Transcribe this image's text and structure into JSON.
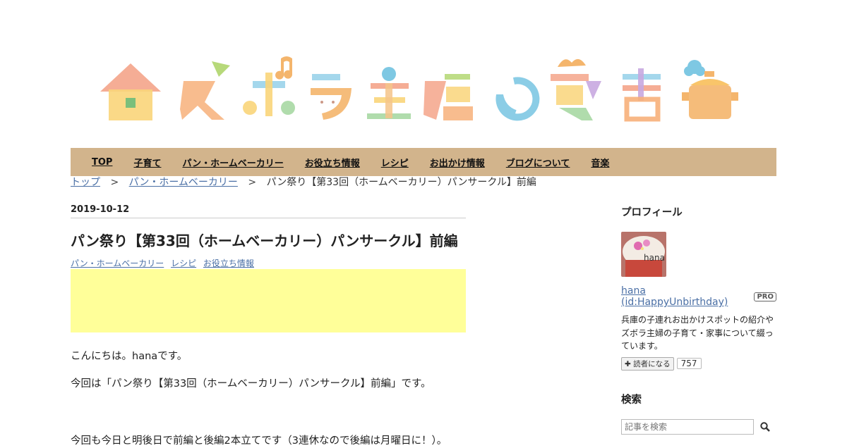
{
  "logo": {
    "alt_text": "ズボラ主婦の覚書"
  },
  "nav": {
    "items": [
      "TOP",
      "子育て",
      "パン・ホームベーカリー",
      "お役立ち情報",
      "レシピ",
      "お出かけ情報",
      "ブログについて",
      "音楽"
    ]
  },
  "breadcrumb": {
    "items": [
      "トップ",
      "パン・ホームベーカリー"
    ],
    "separator": ">",
    "current": "パン祭り【第33回（ホームベーカリー）パンサークル】前編"
  },
  "entry": {
    "date": "2019-10-12",
    "title": "パン祭り【第33回（ホームベーカリー）パンサークル】前編",
    "categories": [
      "パン・ホームベーカリー",
      "レシピ",
      "お役立ち情報"
    ],
    "paragraphs": [
      "こんにちは。hanaです。",
      "今回は「パン祭り【第33回（ホームベーカリー）パンサークル】前編」です。",
      "今回も今日と明後日で前編と後編2本立てです（3連休なので後編は月曜日に！）。"
    ]
  },
  "sidebar": {
    "profile_heading": "プロフィール",
    "avatar_text": "hana",
    "profile_name": "hana (id:HappyUnbirthday)",
    "pro_badge": "PRO",
    "description": "兵庫の子連れお出かけスポットの紹介やズボラ主婦の子育て・家事について綴っています。",
    "subscribe_label": "読者になる",
    "subscriber_count": "757",
    "search_heading": "検索",
    "search_placeholder": "記事を検索"
  },
  "colors": {
    "nav_bg": "#d2b48c",
    "ad_bg": "#ffff99",
    "link": "#4a6fa5"
  }
}
